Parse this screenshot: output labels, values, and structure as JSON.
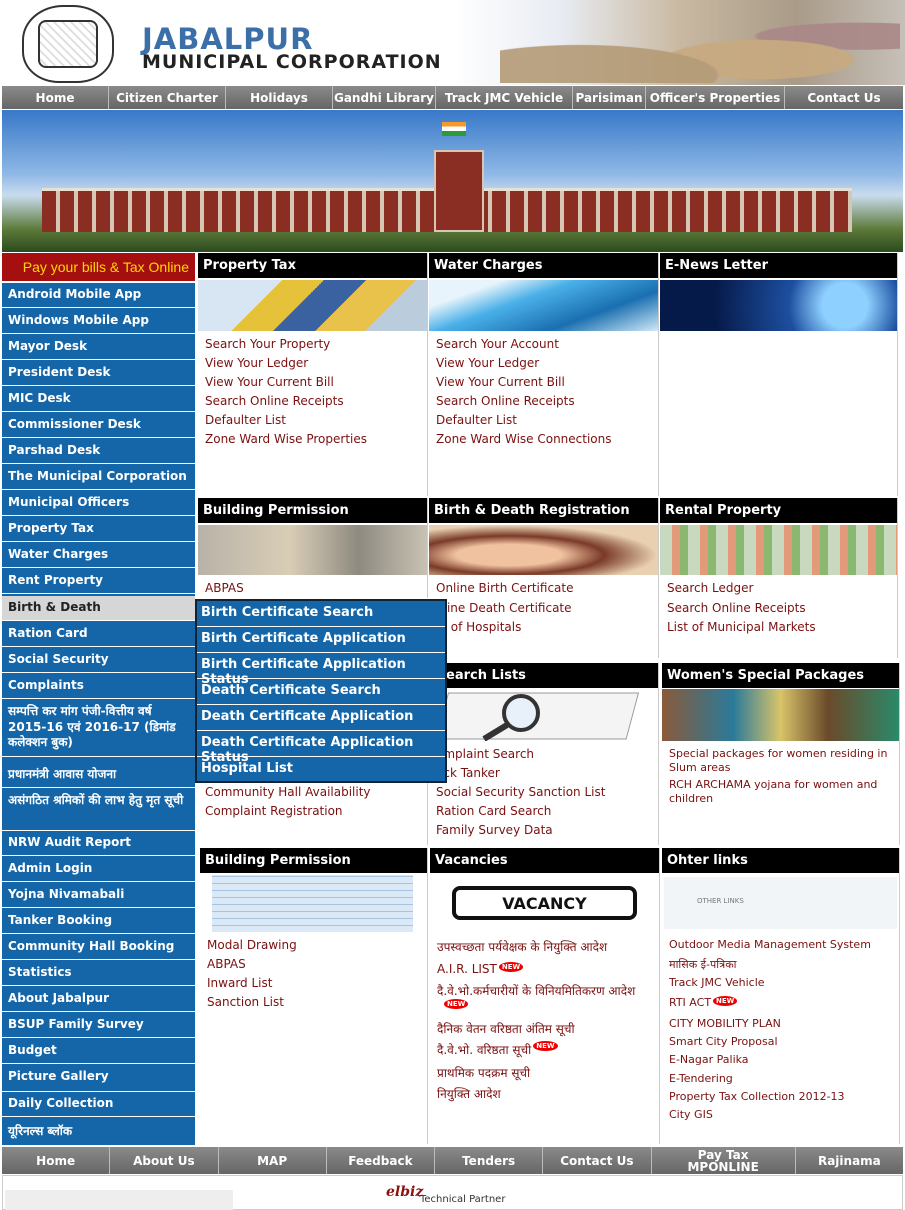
{
  "header": {
    "title1": "JABALPUR",
    "title2": "MUNICIPAL CORPORATION"
  },
  "top_nav": [
    "Home",
    "Citizen Charter",
    "Holidays",
    "Gandhi Library",
    "Track JMC Vehicle",
    "Parisiman",
    "Officer's Properties",
    "Contact Us"
  ],
  "pay_bills": "Pay your bills & Tax Online",
  "left_menu": [
    "Android Mobile App",
    "Windows Mobile App",
    "Mayor Desk",
    "President Desk",
    "MIC Desk",
    "Commissioner Desk",
    "Parshad Desk",
    "The Municipal Corporation",
    "Municipal Officers",
    "Property Tax",
    "Water Charges",
    "Rent Property",
    "Birth & Death",
    "Ration Card",
    "Social Security",
    "Complaints",
    "सम्पत्ति कर मांग पंजी-वित्तीय वर्ष 2015-16 एवं 2016-17 (डिमांड कलेक्शन बुक)",
    "प्रधानमंत्री आवास योजना",
    "असंगठित श्रमिकों की लाभ हेतु मृत सूची",
    "NRW Audit Report",
    "Admin Login",
    "Yojna Nivamabali",
    "Tanker Booking",
    "Community Hall Booking",
    "Statistics",
    "About Jabalpur",
    "BSUP Family Survey",
    "Budget",
    "Picture Gallery",
    "Daily Collection",
    "यूरिनल्स ब्लॉक"
  ],
  "flyout": [
    "Birth Certificate Search",
    "Birth Certificate Application",
    "Birth Certificate Application Status",
    "Death Certificate Search",
    "Death Certificate Application",
    "Death Certificate Application Status",
    "Hospital List"
  ],
  "boxes": {
    "property_tax": {
      "title": "Property Tax",
      "links": [
        "Search Your Property",
        "View Your Ledger",
        "View Your Current Bill",
        "Search Online Receipts",
        "Defaulter List",
        "Zone Ward Wise Properties"
      ]
    },
    "water_charges": {
      "title": "Water Charges",
      "links": [
        "Search Your Account",
        "View Your Ledger",
        "View Your Current Bill",
        "Search Online Receipts",
        "Defaulter List",
        "Zone Ward Wise Connections"
      ]
    },
    "enews": {
      "title": "E-News Letter"
    },
    "building_permission": {
      "title": "Building Permission",
      "links": [
        "ABPAS"
      ]
    },
    "birth_death": {
      "title": "Birth & Death Registration",
      "links": [
        "Online Birth Certificate",
        "nline Death Certificate",
        "st of Hospitals"
      ]
    },
    "rental": {
      "title": "Rental Property",
      "links": [
        "Search Ledger",
        "Search Online Receipts",
        "List of Municipal Markets"
      ]
    },
    "col1_mid": {
      "links": [
        "Community Hall Availability",
        "Complaint Registration"
      ]
    },
    "search_lists": {
      "title": "earch Lists",
      "links": [
        "omplaint Search",
        "ack Tanker",
        "Social Security Sanction List",
        "Ration Card Search",
        "Family Survey Data"
      ]
    },
    "women": {
      "title": "Women's Special Packages",
      "links": [
        "Special packages for women residing in Slum areas",
        "RCH ARCHAMA yojana for women and children"
      ]
    },
    "building_permission2": {
      "title": "Building Permission",
      "links": [
        "Modal Drawing",
        "ABPAS",
        "Inward List",
        "Sanction List"
      ]
    },
    "vacancies": {
      "title": "Vacancies",
      "img_text": "VACANCY",
      "links": [
        "उपस्वच्छता पर्यवेक्षक के नियुक्ति आदेश",
        "A.I.R. LIST",
        "दै.वे.भो.कर्मचारीयों के विनियमितिकरण आदेश",
        "दैनिक वेतन वरिष्ठता अंतिम सूची",
        "दै.वे.भो. वरिष्ठता सूची",
        "प्राथमिक पदक्रम सूची",
        "नियुक्ति आदेश"
      ]
    },
    "other": {
      "title": "Ohter links",
      "img_text": "OTHER LINKS",
      "links": [
        "Outdoor Media Management System",
        "मासिक ई-पत्रिका",
        "Track JMC Vehicle",
        "RTI ACT",
        "CITY MOBILITY PLAN",
        "Smart City Proposal",
        "E-Nagar Palika",
        "E-Tendering",
        "Property Tax Collection 2012-13",
        "City GIS"
      ]
    }
  },
  "new_badge": "NEW",
  "bottom_nav": [
    "Home",
    "About Us",
    "MAP",
    "Feedback",
    "Tenders",
    "Contact Us",
    "Pay Tax MPONLINE",
    "Rajinama"
  ],
  "footer": {
    "brand": "elbiz",
    "partner": "Technical Partner"
  }
}
